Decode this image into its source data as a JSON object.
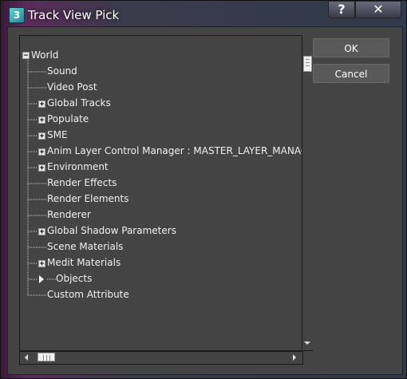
{
  "window": {
    "title": "Track View Pick",
    "help_label": "?",
    "close_label": "✕"
  },
  "buttons": {
    "ok": "OK",
    "cancel": "Cancel"
  },
  "tree": {
    "items": [
      {
        "label": "World"
      },
      {
        "label": "Sound"
      },
      {
        "label": "Video Post"
      },
      {
        "label": "Global Tracks"
      },
      {
        "label": "Populate"
      },
      {
        "label": "SME"
      },
      {
        "label": "Anim Layer Control Manager : MASTER_LAYER_MANAGER"
      },
      {
        "label": "Environment"
      },
      {
        "label": "Render Effects"
      },
      {
        "label": "Render Elements"
      },
      {
        "label": "Renderer"
      },
      {
        "label": "Global Shadow Parameters"
      },
      {
        "label": "Scene Materials"
      },
      {
        "label": "Medit Materials"
      },
      {
        "label": "Objects"
      },
      {
        "label": "Custom Attribute"
      }
    ]
  }
}
